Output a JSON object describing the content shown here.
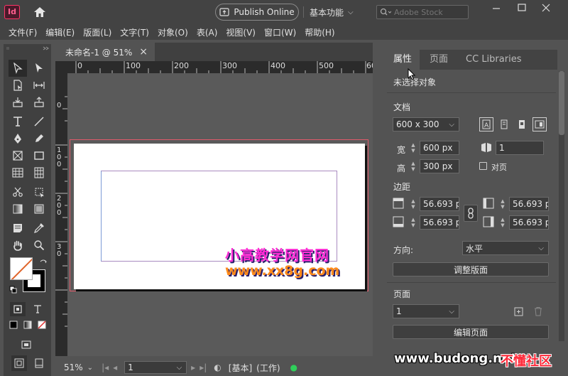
{
  "app": {
    "logo_text": "Id",
    "publish_label": "Publish Online",
    "workspace_label": "基本功能",
    "stock_placeholder": "Adobe Stock"
  },
  "menu": [
    "文件(F)",
    "编辑(E)",
    "版面(L)",
    "文字(T)",
    "对象(O)",
    "表(A)",
    "视图(V)",
    "窗口(W)",
    "帮助(H)"
  ],
  "document": {
    "tab_title": "未命名-1 @ 51%",
    "close_glyph": "×"
  },
  "ruler": {
    "h_ticks": [
      "0",
      "100",
      "200",
      "300",
      "400",
      "500",
      "60"
    ],
    "v_ticks": [
      "0",
      "1",
      "0",
      "0",
      "2",
      "0",
      "0",
      "3",
      "0"
    ]
  },
  "canvas": {
    "watermark_cn": "小高教学网官网",
    "watermark_url": "www.xx8g.com"
  },
  "status": {
    "zoom": "51%",
    "page": "1",
    "style": "[基本]",
    "mode": "(工作)"
  },
  "panel": {
    "tabs": [
      "属性",
      "页面",
      "CC Libraries"
    ],
    "no_selection": "未选择对象",
    "document_heading": "文档",
    "preset": "600 x 300",
    "width_label": "宽",
    "width_value": "600 px",
    "height_label": "高",
    "height_value": "300 px",
    "pages_value": "1",
    "facing_label": "对页",
    "margins_heading": "边距",
    "margin_top": "56.693 p",
    "margin_bottom": "56.693 p",
    "margin_left": "56.693 p",
    "margin_right": "56.693 p",
    "orientation_label": "方向:",
    "orientation_value": "水平",
    "adjust_layout_btn": "调整版面",
    "pages_heading": "页面",
    "page_select": "1",
    "edit_page_btn": "编辑页面"
  },
  "watermark_footer": {
    "site": "www.budong.net",
    "brand": "不懂社区"
  },
  "colors": {
    "accent_magenta": "#ff3366",
    "bleed_red": "#e05a6a",
    "margin_purple": "#a98bc0"
  }
}
